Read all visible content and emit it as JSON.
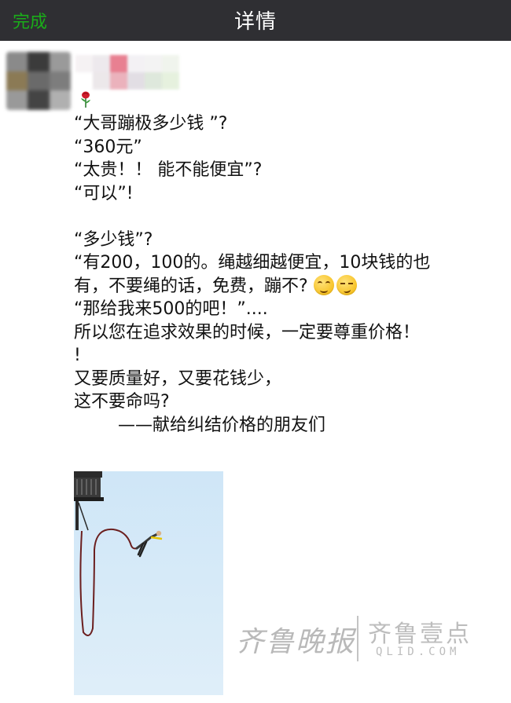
{
  "navbar": {
    "done_label": "完成",
    "title": "详情"
  },
  "post": {
    "lines": [
      "“大哥蹦极多少钱 ”?",
      "“360元”",
      "“太贵！！ 能不能便宜”?",
      "“可以”!",
      "",
      "“多少钱”?",
      "“有200，100的。绳越细越便宜，10块钱的也",
      "有，不要绳的话，免费，蹦不?",
      "“那给我来500的吧！”....",
      "所以您在追求效果的时候，一定要尊重价格！",
      "!",
      "又要质量好，又要花钱少，",
      "这不要命吗?",
      "        ——献给纠结价格的朋友们"
    ],
    "emojis": [
      "grin-face-icon",
      "smirk-face-icon"
    ]
  },
  "watermark": {
    "left": "齐鲁晚报",
    "right": "齐鲁壹点",
    "url": "QLID.COM"
  }
}
